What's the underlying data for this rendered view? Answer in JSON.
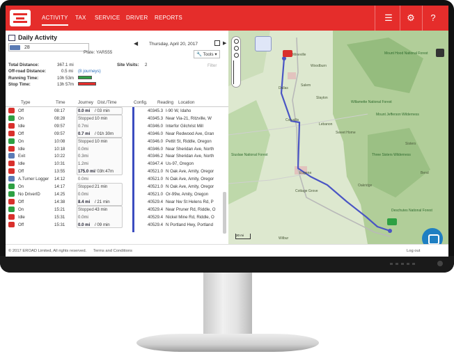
{
  "nav": {
    "items": [
      {
        "label": "ACTIVITY",
        "active": true
      },
      {
        "label": "TAX",
        "active": false
      },
      {
        "label": "SERVICE",
        "active": false
      },
      {
        "label": "DRIVER",
        "active": false
      },
      {
        "label": "REPORTS",
        "active": false
      }
    ],
    "icons": [
      "checklist-icon",
      "gear-icon",
      "help-icon"
    ],
    "accent": "#e52d2b"
  },
  "header": {
    "title": "Daily Activity",
    "vehicle_number": "28",
    "plate": "Plate: YAR555",
    "date": "Thursday, April 20, 2017",
    "tools_label": "Tools",
    "filter_label": "Filter"
  },
  "stats": {
    "total_distance_label": "Total Distance:",
    "total_distance_value": "367.1 mi",
    "offroad_label": "Off-road Distance:",
    "offroad_value": "0.5 mi",
    "journeys_link": "(8 journeys)",
    "site_visits_label": "Site Visits:",
    "site_visits_value": "2",
    "running_label": "Running Time:",
    "running_value": "10h 53m",
    "stop_label": "Stop Time:",
    "stop_value": "13h 57m",
    "running_color": "#2ea043",
    "stop_color": "#e52d2b"
  },
  "table": {
    "headers": [
      "Type",
      "Time",
      "Journey",
      "Dist./Time",
      "Config.",
      "Reading",
      "Location"
    ],
    "rows": [
      {
        "icon": "off-icon",
        "color": "#d9302c",
        "type": "Off",
        "time": "08:17",
        "jd": "0.0 mi",
        "jd_bold": true,
        "dt": "/ 03 min",
        "reading": "40345.3",
        "location": "I-90 W, Idaho"
      },
      {
        "icon": "on-icon",
        "color": "#2ea043",
        "type": "On",
        "time": "08:28",
        "jd": "Stopped",
        "jd_bold": false,
        "dt": "10 min",
        "reading": "40345.3",
        "location": "Near Via-21, Ritzville, W"
      },
      {
        "icon": "idle-icon",
        "color": "#d9302c",
        "type": "Idle",
        "time": "09:57",
        "jd": "0.7mi",
        "jd_bold": false,
        "dt": "",
        "reading": "40346.0",
        "location": "Interfor Gilchrist Mill"
      },
      {
        "icon": "off-icon",
        "color": "#d9302c",
        "type": "Off",
        "time": "09:57",
        "jd": "0.7 mi",
        "jd_bold": true,
        "dt": "/ 01h 30m",
        "reading": "40346.0",
        "location": "Near Redwood Ave, Gran"
      },
      {
        "icon": "on-icon",
        "color": "#2ea043",
        "type": "On",
        "time": "10:08",
        "jd": "Stopped",
        "jd_bold": false,
        "dt": "10 min",
        "reading": "40346.0",
        "location": "Pettit St, Riddle, Oregon"
      },
      {
        "icon": "idle-icon",
        "color": "#d9302c",
        "type": "Idle",
        "time": "10:18",
        "jd": "0.0mi",
        "jd_bold": false,
        "dt": "",
        "reading": "40346.0",
        "location": "Near Sheridan Ave, North"
      },
      {
        "icon": "exit-icon",
        "color": "#5b7bb5",
        "type": "Exit",
        "time": "10:22",
        "jd": "0.3mi",
        "jd_bold": false,
        "dt": "",
        "reading": "40346.2",
        "location": "Near Sheridan Ave, North"
      },
      {
        "icon": "idle-icon",
        "color": "#d9302c",
        "type": "Idle",
        "time": "10:31",
        "jd": "1.2mi",
        "jd_bold": false,
        "dt": "",
        "reading": "40347.4",
        "location": "Us-97, Oregon"
      },
      {
        "icon": "off-icon",
        "color": "#d9302c",
        "type": "Off",
        "time": "13:55",
        "jd": "175.0 mi",
        "jd_bold": true,
        "dt": "/ 03h:47m",
        "reading": "40521.0",
        "location": "N Oak Ave, Amity, Oregor"
      },
      {
        "icon": "logger-icon",
        "color": "#5b7bb5",
        "type": "A.Turner Logger",
        "time": "14:12",
        "jd": "0.0mi",
        "jd_bold": false,
        "dt": "",
        "reading": "40521.0",
        "location": "N Oak Ave, Amity, Oregor"
      },
      {
        "icon": "on-icon",
        "color": "#2ea043",
        "type": "On",
        "time": "14:17",
        "jd": "Stopped",
        "jd_bold": false,
        "dt": "21 min",
        "reading": "40521.0",
        "location": "N Oak Ave, Amity, Oregor"
      },
      {
        "icon": "driver-icon",
        "color": "#2ea043",
        "type": "No DriverID",
        "time": "14:25",
        "jd": "0.0mi",
        "jd_bold": false,
        "dt": "",
        "reading": "40521.0",
        "location": "Or-99w, Amity, Oregon"
      },
      {
        "icon": "off-icon",
        "color": "#d9302c",
        "type": "Off",
        "time": "14:38",
        "jd": "8.4 mi",
        "jd_bold": true,
        "dt": "/ 21 min",
        "reading": "40529.4",
        "location": "Near Nw St Helens Rd, P"
      },
      {
        "icon": "on-icon",
        "color": "#2ea043",
        "type": "On",
        "time": "15:21",
        "jd": "Stopped",
        "jd_bold": false,
        "dt": "43 min",
        "reading": "40529.4",
        "location": "Near Pruner Rd, Riddle, O"
      },
      {
        "icon": "idle-icon",
        "color": "#d9302c",
        "type": "Idle",
        "time": "15:31",
        "jd": "0.0mi",
        "jd_bold": false,
        "dt": "",
        "reading": "40529.4",
        "location": "Nickel Mine Rd, Riddle, O"
      },
      {
        "icon": "off-icon",
        "color": "#d9302c",
        "type": "Off",
        "time": "15:31",
        "jd": "0.0 mi",
        "jd_bold": true,
        "dt": "/ 09 min",
        "reading": "40529.4",
        "location": "N Portland Hwy, Portland"
      }
    ]
  },
  "map": {
    "labels": [
      "Dallas",
      "Salem",
      "Corvallis",
      "Lebanon",
      "Sweet Home",
      "Eugene",
      "Cottage Grove",
      "Oakridge",
      "Bend",
      "Sisters",
      "Wilbur",
      "Woodburn",
      "Mount Hood National Forest",
      "Willamette National Forest",
      "Deschutes National Forest",
      "Mount Jefferson Wilderness",
      "Three Sisters Wilderness",
      "Siuslaw National Forest",
      "Slayton",
      "Mineville"
    ],
    "scale": "20 mi",
    "route_color": "#4a55c4"
  },
  "footer": {
    "copyright": "© 2017 EROAD Limited, All rights reserved.",
    "terms": "Terms and Conditions",
    "logout": "Log out"
  }
}
